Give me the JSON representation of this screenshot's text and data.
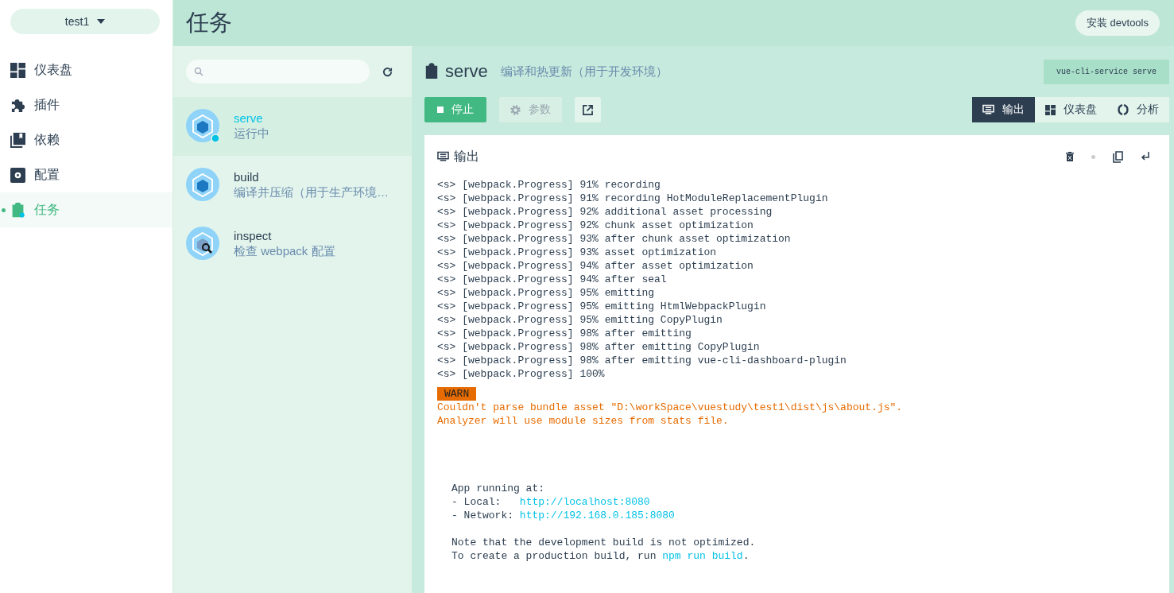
{
  "project_selector": {
    "label": "test1"
  },
  "nav": [
    {
      "label": "仪表盘",
      "selected": false
    },
    {
      "label": "插件",
      "selected": false
    },
    {
      "label": "依赖",
      "selected": false
    },
    {
      "label": "配置",
      "selected": false
    },
    {
      "label": "任务",
      "selected": true
    }
  ],
  "header": {
    "title": "任务",
    "devtools_button": "安装 devtools"
  },
  "tasks": [
    {
      "name": "serve",
      "description": "运行中",
      "selected": true,
      "running": true,
      "kind": "cube"
    },
    {
      "name": "build",
      "description": "编译并压缩（用于生产环境…",
      "selected": false,
      "running": false,
      "kind": "cube"
    },
    {
      "name": "inspect",
      "description": "检查 webpack 配置",
      "selected": false,
      "running": false,
      "kind": "inspect"
    }
  ],
  "task_detail": {
    "name": "serve",
    "description": "编译和热更新（用于开发环境）",
    "command": "vue-cli-service serve",
    "stop_button": "停止",
    "params_button": {
      "label": "参数",
      "disabled": true
    },
    "views": [
      {
        "label": "输出",
        "selected": true
      },
      {
        "label": "仪表盘",
        "selected": false
      },
      {
        "label": "分析",
        "selected": false
      }
    ]
  },
  "output": {
    "title": "输出",
    "log": [
      "<s> [webpack.Progress] 91% recording",
      "<s> [webpack.Progress] 91% recording HotModuleReplacementPlugin",
      "<s> [webpack.Progress] 92% additional asset processing",
      "<s> [webpack.Progress] 92% chunk asset optimization",
      "<s> [webpack.Progress] 93% after chunk asset optimization",
      "<s> [webpack.Progress] 93% asset optimization",
      "<s> [webpack.Progress] 94% after asset optimization",
      "<s> [webpack.Progress] 94% after seal",
      "<s> [webpack.Progress] 95% emitting",
      "<s> [webpack.Progress] 95% emitting HtmlWebpackPlugin",
      "<s> [webpack.Progress] 95% emitting CopyPlugin",
      "<s> [webpack.Progress] 98% after emitting",
      "<s> [webpack.Progress] 98% after emitting CopyPlugin",
      "<s> [webpack.Progress] 98% after emitting vue-cli-dashboard-plugin",
      "<s> [webpack.Progress] 100%"
    ],
    "warn": {
      "label": "WARN",
      "lines": [
        "Couldn't parse bundle asset \"D:\\workSpace\\vuestudy\\test1\\dist\\js\\about.js\".",
        "Analyzer will use module sizes from stats file."
      ]
    },
    "info_groups": [
      {
        "lines": [
          {
            "parts": [
              {
                "text": "App running at:",
                "link": false
              }
            ]
          },
          {
            "parts": [
              {
                "text": "- Local:   ",
                "link": false
              },
              {
                "text": "http://localhost:8080",
                "link": true
              }
            ]
          },
          {
            "parts": [
              {
                "text": "- Network: ",
                "link": false
              },
              {
                "text": "http://192.168.0.185:8080",
                "link": true
              }
            ]
          }
        ]
      },
      {
        "lines": [
          {
            "parts": [
              {
                "text": "Note that the development build is not optimized.",
                "link": false
              }
            ]
          },
          {
            "parts": [
              {
                "text": "To create a production build, run ",
                "link": false
              },
              {
                "text": "npm run build",
                "link": true
              },
              {
                "text": ".",
                "link": false
              }
            ]
          }
        ]
      }
    ]
  }
}
